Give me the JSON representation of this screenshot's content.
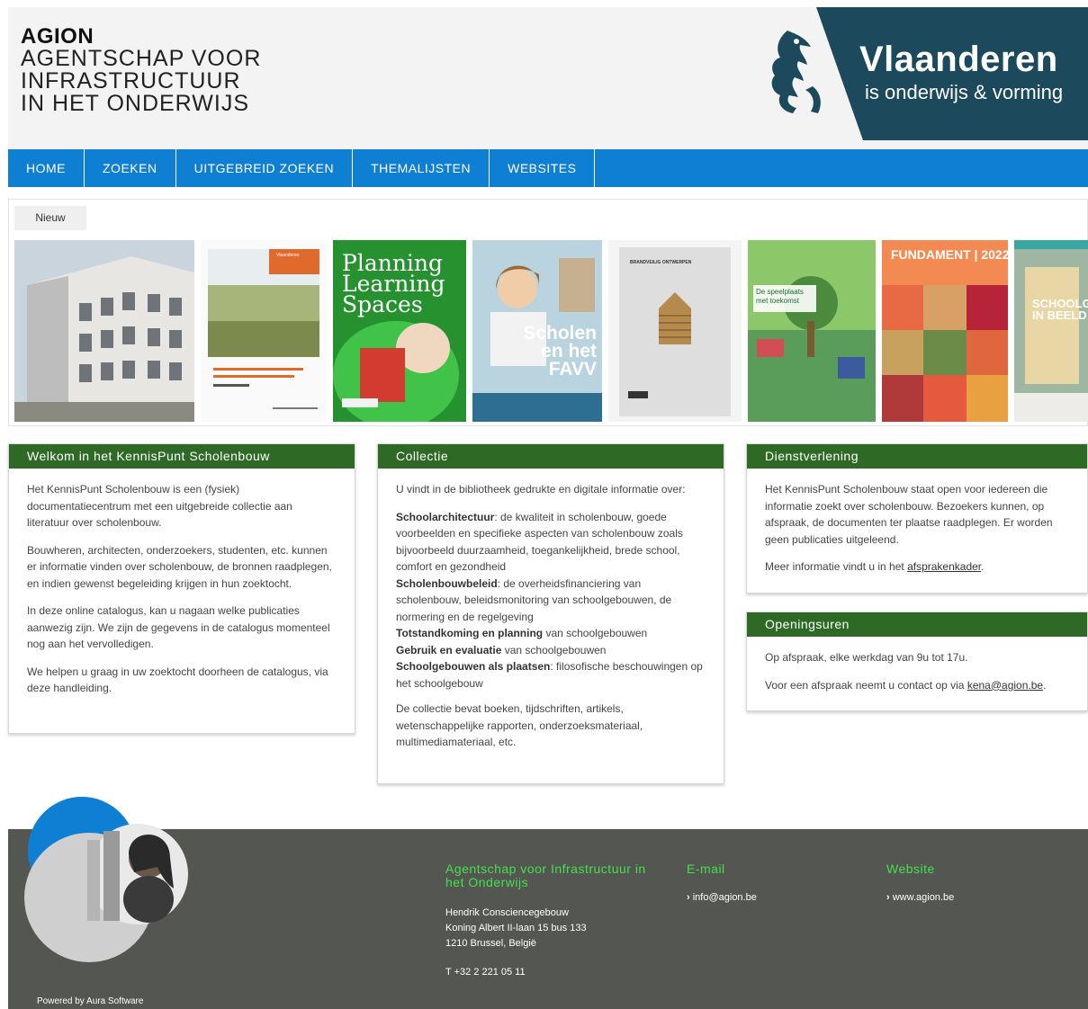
{
  "header": {
    "logo_acronym": "AGION",
    "logo_line1": "AGENTSCHAP VOOR",
    "logo_line2": "INFRASTRUCTUUR",
    "logo_line3": "IN HET ONDERWIJS",
    "brand_title": "Vlaanderen",
    "brand_subtitle": "is onderwijs & vorming"
  },
  "nav": {
    "items": [
      "HOME",
      "ZOEKEN",
      "UITGEBREID ZOEKEN",
      "THEMALIJSTEN",
      "WEBSITES"
    ]
  },
  "new_section": {
    "tab_label": "Nieuw",
    "covers": [
      {
        "text": ""
      },
      {
        "text": "Vlaanderen"
      },
      {
        "text": "Planning Learning Spaces"
      },
      {
        "text": "Scholen en het FAVV"
      },
      {
        "text": "BRANDVEILIG ONTWERPEN"
      },
      {
        "text": "De speelplaats met toekomst"
      },
      {
        "text": "FUNDAMENT | 2022"
      },
      {
        "text": "SCHOOLGEBOUW IN BEELD"
      }
    ]
  },
  "welcome": {
    "title": "Welkom in het KennisPunt Scholenbouw",
    "p1": "Het KennisPunt Scholenbouw is een (fysiek) documentatiecentrum met een uitgebreide collectie aan literatuur over scholenbouw.",
    "p2": "Bouwheren, architecten, onderzoekers, studenten, etc. kunnen er informatie vinden over scholenbouw, de bronnen raadplegen, en indien gewenst begeleiding krijgen in hun zoektocht.",
    "p3": "In deze online catalogus, kan u nagaan welke publicaties aanwezig zijn. We zijn de gegevens in de catalogus momenteel nog aan het vervolledigen.",
    "p4": "We helpen u graag in uw zoektocht doorheen de catalogus, via deze handleiding."
  },
  "collectie": {
    "title": "Collectie",
    "intro": "U vindt in de bibliotheek gedrukte en digitale informatie over:",
    "items": [
      {
        "term": "Schoolarchitectuur",
        "text": ": de kwaliteit in scholenbouw, goede voorbeelden en specifieke aspecten van scholenbouw zoals bijvoorbeeld duurzaamheid, toegankelijkheid, brede school, comfort en gezondheid"
      },
      {
        "term": "Scholenbouwbeleid",
        "text": ": de overheidsfinanciering van scholenbouw, beleidsmonitoring van schoolgebouwen, de normering en de regelgeving"
      },
      {
        "term": "Totstandkoming en planning",
        "text": " van schoolgebouwen"
      },
      {
        "term": "Gebruik en evaluatie",
        "text": " van schoolgebouwen"
      },
      {
        "term": "Schoolgebouwen als plaatsen",
        "text": ": filosofische beschouwingen op het schoolgebouw"
      }
    ],
    "outro": "De collectie bevat boeken, tijdschriften, artikels, wetenschappelijke rapporten, onderzoeksmateriaal, multimediamateriaal, etc."
  },
  "dienst": {
    "title": "Dienstverlening",
    "p1": "Het KennisPunt Scholenbouw staat open voor iedereen die informatie zoekt over scholenbouw. Bezoekers kunnen, op afspraak, de documenten ter plaatse raadplegen. Er worden geen publicaties uitgeleend.",
    "p2_prefix": "Meer informatie vindt u in het ",
    "p2_link": "afsprakenkader",
    "p2_suffix": "."
  },
  "uren": {
    "title": "Openingsuren",
    "p1": "Op afspraak, elke werkdag van 9u tot 17u.",
    "p2_prefix": "Voor een afspraak neemt u contact op via ",
    "p2_link": "kena@agion.be",
    "p2_suffix": "."
  },
  "footer": {
    "org_title": "Agentschap voor Infrastructuur in het Onderwijs",
    "address_line1": "Hendrik Consciencegebouw",
    "address_line2": "Koning Albert II-laan 15 bus 133",
    "address_line3": "1210 Brussel, België",
    "phone": "T +32 2 221 05 11",
    "email_title": "E-mail",
    "email": "info@agion.be",
    "website_title": "Website",
    "website": "www.agion.be",
    "powered": "Powered by Aura Software"
  },
  "colors": {
    "nav": "#0f7fd4",
    "panel_head": "#2e6a26",
    "footer": "#545652",
    "footer_title": "#43e04a",
    "brand_block": "#1c4a5c"
  }
}
